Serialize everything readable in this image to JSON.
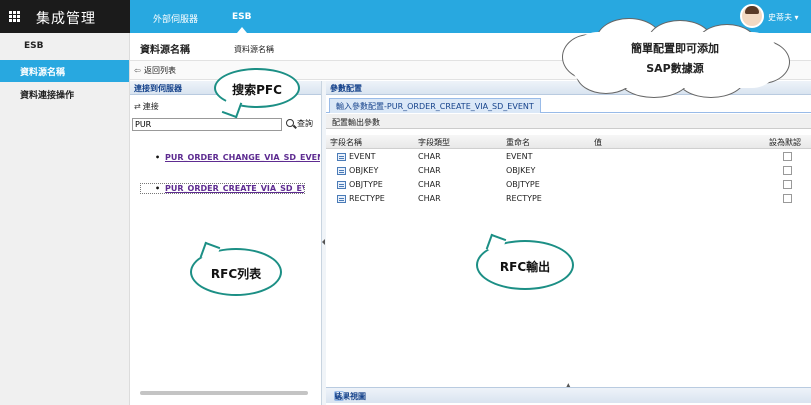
{
  "app": {
    "title": "集成管理"
  },
  "nav": {
    "tabs": [
      {
        "label": "外部伺服器"
      },
      {
        "label": "ESB"
      }
    ],
    "user": "史蒂夫"
  },
  "sidebar": {
    "items": [
      {
        "label": "ESB"
      },
      {
        "label": "資料源名稱"
      },
      {
        "label": "資料連接操作"
      }
    ]
  },
  "page": {
    "title": "資料源名稱",
    "subtitle": "資料源名稱",
    "back_label": "返回列表"
  },
  "left_panel": {
    "header": "連接到伺服器",
    "connect_label": "連接",
    "search": {
      "value": "PUR",
      "button": "查詢"
    },
    "rfc_items": [
      "PUR_ORDER_CHANGE_VIA_SD_EVENT",
      "PUR_ORDER_CREATE_VIA_SD_EVENT"
    ]
  },
  "right_panel": {
    "header": "參數配置",
    "tab": "輸入參數配置-PUR_ORDER_CREATE_VIA_SD_EVENT",
    "subheader": "配置輸出參數",
    "columns": [
      "字段名稱",
      "字段類型",
      "重命名",
      "值",
      "設為默認"
    ],
    "rows": [
      {
        "name": "EVENT",
        "type": "CHAR",
        "rename": "EVENT",
        "value": ""
      },
      {
        "name": "OBJKEY",
        "type": "CHAR",
        "rename": "OBJKEY",
        "value": ""
      },
      {
        "name": "OBJTYPE",
        "type": "CHAR",
        "rename": "OBJTYPE",
        "value": ""
      },
      {
        "name": "RECTYPE",
        "type": "CHAR",
        "rename": "RECTYPE",
        "value": ""
      }
    ],
    "result_label": "結果視圖"
  },
  "callouts": {
    "search_pfc": "搜索PFC",
    "rfc_list": "RFC列表",
    "rfc_output": "RFC輸出",
    "cloud_line1": "簡單配置即可添加",
    "cloud_line2": "SAP數據源"
  },
  "colors": {
    "topbar": "#28a8e0",
    "brand": "#1b1b1b",
    "accent": "#28a8e0",
    "callout_border": "#1c8f85",
    "link": "#5e2c91"
  },
  "icons": [
    "grid-icon",
    "avatar",
    "back-arrow-icon",
    "connect-icon",
    "search-icon",
    "field-icon",
    "collapse-icon"
  ]
}
